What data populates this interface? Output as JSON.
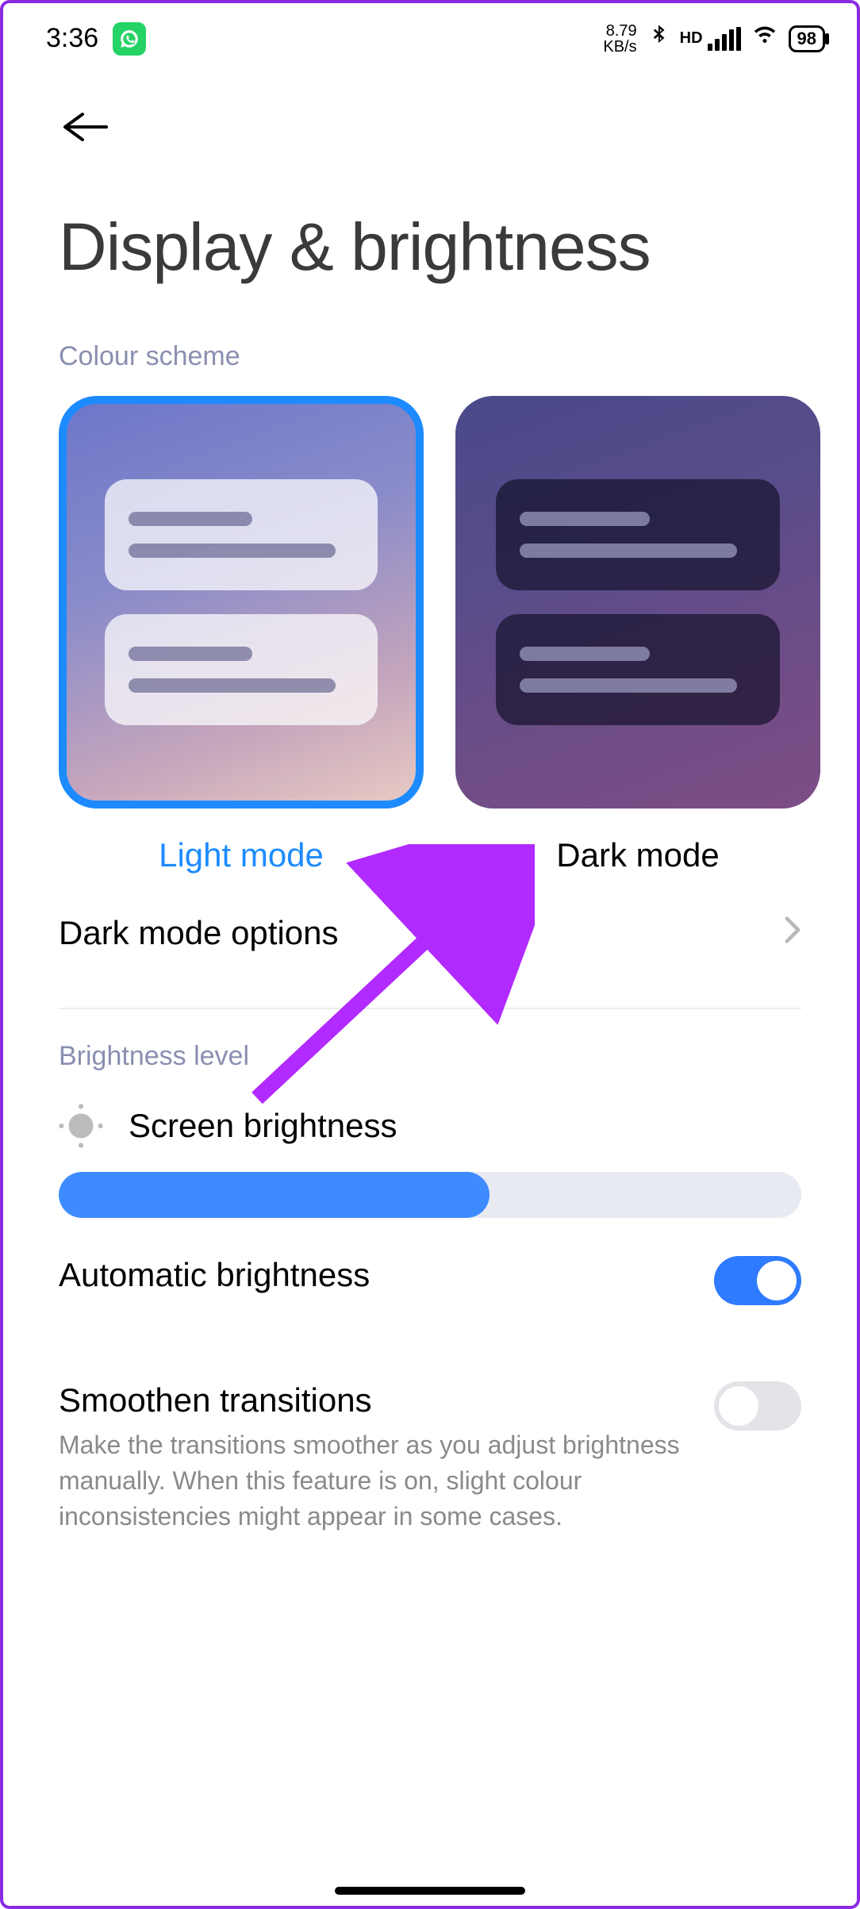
{
  "status": {
    "time": "3:36",
    "net_speed_top": "8.79",
    "net_speed_bottom": "KB/s",
    "hd": "HD",
    "battery": "98"
  },
  "header": {
    "title": "Display & brightness"
  },
  "colour_scheme": {
    "label": "Colour scheme",
    "light_label": "Light mode",
    "dark_label": "Dark mode",
    "selected": "light"
  },
  "dark_mode_options": {
    "label": "Dark mode options"
  },
  "brightness": {
    "section_label": "Brightness level",
    "row_label": "Screen brightness",
    "percent": 58
  },
  "auto_brightness": {
    "label": "Automatic brightness",
    "enabled": true
  },
  "smoothen": {
    "label": "Smoothen transitions",
    "description": "Make the transitions smoother as you adjust brightness manually. When this feature is on, slight colour inconsistencies might appear in some cases.",
    "enabled": false
  },
  "colors": {
    "accent": "#1d8bff",
    "annotation": "#b12aff"
  }
}
